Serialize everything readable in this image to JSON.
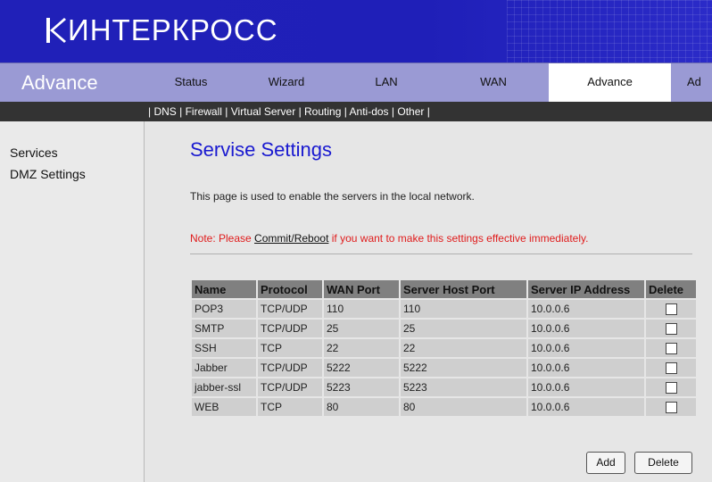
{
  "header": {
    "logo_text": "ИНТЕРКРОСС",
    "brand_color": "#1f1fb8"
  },
  "topnav": {
    "section_title": "Advance",
    "tabs": [
      {
        "label": "Status"
      },
      {
        "label": "Wizard"
      },
      {
        "label": "LAN"
      },
      {
        "label": "WAN"
      },
      {
        "label": "Advance",
        "active": true
      },
      {
        "label": "Ad"
      }
    ]
  },
  "subnav": {
    "links": [
      "DNS",
      "Firewall",
      "Virtual Server",
      "Routing",
      "Anti-dos",
      "Other"
    ]
  },
  "sidebar": {
    "items": [
      {
        "label": "Services"
      },
      {
        "label": "DMZ Settings"
      }
    ]
  },
  "main": {
    "title": "Servise Settings",
    "description": "This page is used to enable the servers in the local network.",
    "note_prefix": "Note: Please ",
    "note_link": "Commit/Reboot",
    "note_suffix": " if you want to make this settings effective immediately.",
    "table": {
      "columns": [
        "Name",
        "Protocol",
        "WAN Port",
        "Server Host Port",
        "Server IP Address",
        "Delete"
      ],
      "rows": [
        {
          "name": "POP3",
          "protocol": "TCP/UDP",
          "wan_port": "110",
          "host_port": "110",
          "ip": "10.0.0.6",
          "delete": false
        },
        {
          "name": "SMTP",
          "protocol": "TCP/UDP",
          "wan_port": "25",
          "host_port": "25",
          "ip": "10.0.0.6",
          "delete": false
        },
        {
          "name": "SSH",
          "protocol": "TCP",
          "wan_port": "22",
          "host_port": "22",
          "ip": "10.0.0.6",
          "delete": false
        },
        {
          "name": "Jabber",
          "protocol": "TCP/UDP",
          "wan_port": "5222",
          "host_port": "5222",
          "ip": "10.0.0.6",
          "delete": false
        },
        {
          "name": "jabber-ssl",
          "protocol": "TCP/UDP",
          "wan_port": "5223",
          "host_port": "5223",
          "ip": "10.0.0.6",
          "delete": false
        },
        {
          "name": "WEB",
          "protocol": "TCP",
          "wan_port": "80",
          "host_port": "80",
          "ip": "10.0.0.6",
          "delete": false
        }
      ]
    },
    "buttons": {
      "add": "Add",
      "delete": "Delete"
    }
  }
}
